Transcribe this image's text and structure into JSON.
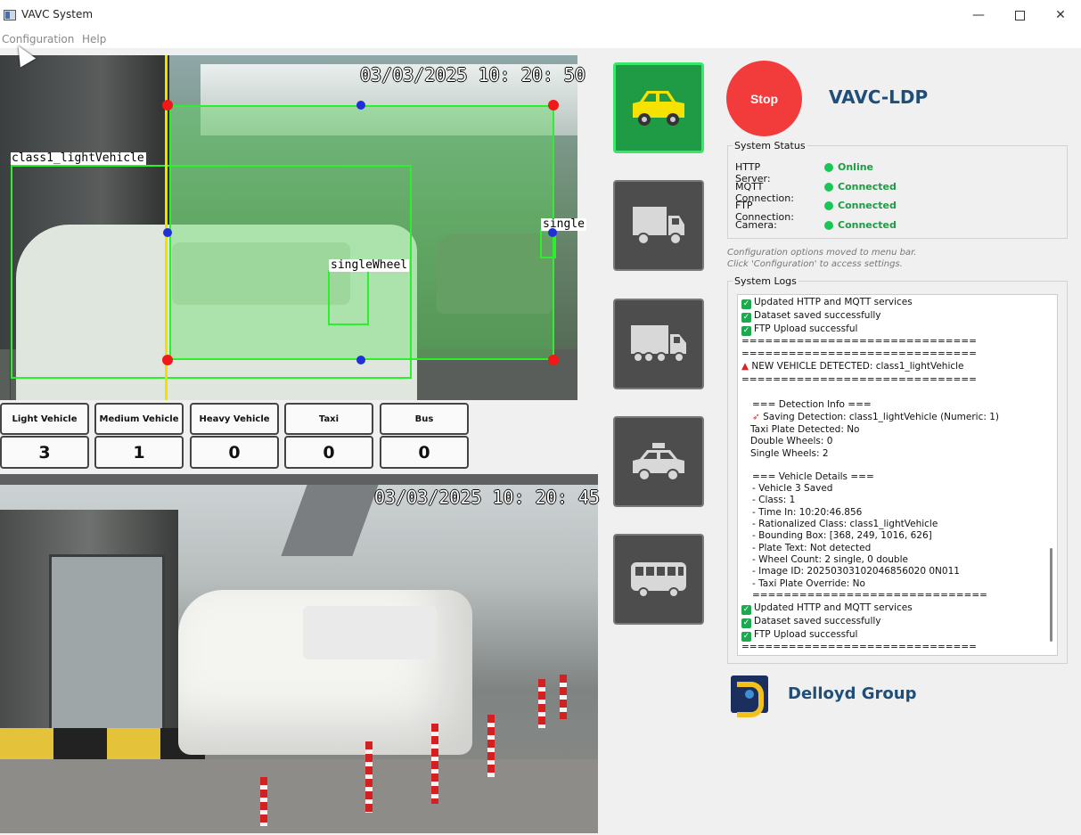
{
  "window": {
    "title": "VAVC System",
    "min": "—",
    "close": "✕"
  },
  "menu": {
    "configuration": "Configuration",
    "help": "Help"
  },
  "camera1": {
    "timestamp": "03/03/2025 10: 20: 50",
    "labels": {
      "vehicle": "class1_lightVehicle",
      "wheel": "singleWheel",
      "single": "single"
    }
  },
  "counters": [
    {
      "label": "Light Vehicle",
      "value": "3"
    },
    {
      "label": "Medium Vehicle",
      "value": "1"
    },
    {
      "label": "Heavy Vehicle",
      "value": "0"
    },
    {
      "label": "Taxi",
      "value": "0"
    },
    {
      "label": "Bus",
      "value": "0"
    }
  ],
  "camera2": {
    "timestamp": "03/03/2025 10: 20: 45"
  },
  "controls": {
    "stop": "Stop",
    "app_title": "VAVC-LDP"
  },
  "system_status": {
    "title": "System Status",
    "rows": [
      {
        "label": "HTTP Server:",
        "value": "Online"
      },
      {
        "label": "MQTT Connection:",
        "value": "Connected"
      },
      {
        "label": "FTP Connection:",
        "value": "Connected"
      },
      {
        "label": "Camera:",
        "value": "Connected"
      }
    ],
    "led_color": "#19c656"
  },
  "note": {
    "line1": "Configuration options moved to menu bar.",
    "line2": "Click 'Configuration' to access settings."
  },
  "logs": {
    "title": "System Logs",
    "lines": [
      "Updated HTTP and MQTT services",
      "Dataset saved successfully",
      "FTP Upload successful",
      "==============================",
      "==============================",
      "NEW VEHICLE DETECTED: class1_lightVehicle",
      "==============================",
      "=== Detection Info ===",
      "Saving Detection: class1_lightVehicle (Numeric: 1)",
      "Taxi Plate Detected: No",
      "Double Wheels: 0",
      "Single Wheels: 2",
      "=== Vehicle Details ===",
      "- Vehicle 3 Saved",
      "- Class: 1",
      "- Time In: 10:20:46.856",
      "- Rationalized Class: class1_lightVehicle",
      "- Bounding Box: [368, 249, 1016, 626]",
      "- Plate Text: Not detected",
      "- Wheel Count: 2 single, 0 double",
      "- Image ID: 20250303102046856020 0N011",
      "- Taxi Plate Override: No",
      "==============================",
      "Updated HTTP and MQTT services",
      "Dataset saved successfully",
      "FTP Upload successful",
      "=============================="
    ]
  },
  "company": {
    "name": "Delloyd Group"
  },
  "colors": {
    "accent": "#1f4e79",
    "active_green": "#1f9a45",
    "stop_red": "#f23c3c"
  }
}
